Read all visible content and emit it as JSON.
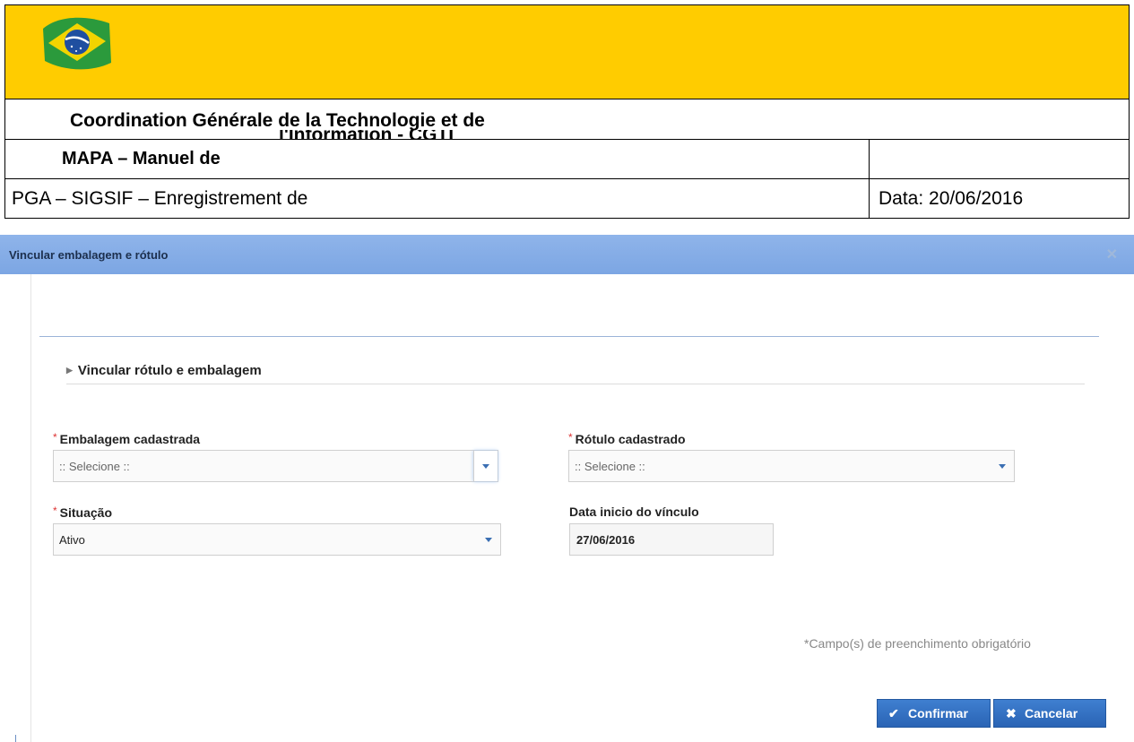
{
  "doc_header": {
    "coordination": "Coordination Générale de la Technologie et de",
    "coordination_cut": "l'Information - CGTI",
    "manual": "MAPA – Manuel de",
    "pga": "PGA – SIGSIF – Enregistrement de",
    "date": "Data: 20/06/2016"
  },
  "dialog": {
    "title": "Vincular embalagem e rótulo",
    "close_symbol": "✕",
    "section_title": "Vincular rótulo e embalagem",
    "required_mark": "*",
    "fields": {
      "embalagem": {
        "label": "Embalagem cadastrada",
        "value": ":: Selecione ::"
      },
      "rotulo": {
        "label": "Rótulo cadastrado",
        "value": ":: Selecione ::"
      },
      "situacao": {
        "label": "Situação",
        "value": "Ativo"
      },
      "data_inicio": {
        "label": "Data inicio do vínculo",
        "value": "27/06/2016"
      }
    },
    "required_note": "*Campo(s) de preenchimento obrigatório",
    "buttons": {
      "confirm_icon": "✔",
      "confirm": "Confirmar",
      "cancel_icon": "✖",
      "cancel": "Cancelar"
    }
  },
  "colors": {
    "header_yellow": "#ffcc00",
    "dialog_title_blue": "#7ca6e3",
    "button_blue": "#2f6cc0",
    "required_red": "#d33"
  }
}
